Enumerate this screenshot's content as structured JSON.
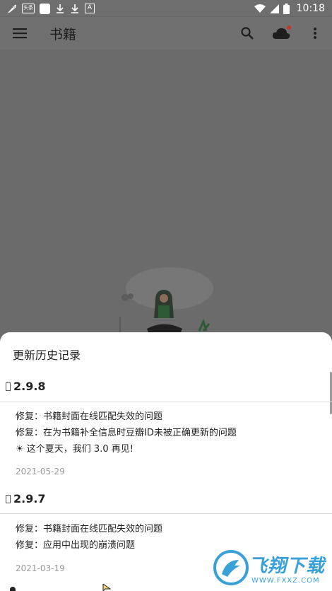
{
  "status_bar": {
    "icons_left": [
      "feather-icon",
      "news-app-icon",
      "square-app-icon",
      "download-icon",
      "download-icon",
      "font-a-icon"
    ],
    "news_badge": "头条",
    "a_badge": "A",
    "time": "10:18",
    "icons_right": [
      "wifi-icon",
      "signal-icon",
      "battery-icon"
    ]
  },
  "app_bar": {
    "title": "书籍",
    "icons": [
      "menu-icon",
      "search-icon",
      "cloud-icon",
      "more-vert-icon"
    ],
    "cloud_badge_color": "#c0392b"
  },
  "sheet": {
    "title": "更新历史记录",
    "versions": [
      {
        "version": "2.9.8",
        "items": [
          "修复：书籍封面在线匹配失效的问题",
          "修复：在为书籍补全信息时豆瓣ID未被正确更新的问题",
          "☀ 这个夏天，我们 3.0 再见!"
        ],
        "date": "2021-05-29"
      },
      {
        "version": "2.9.7",
        "items": [
          "修复：书籍封面在线匹配失效的问题",
          "修复：应用中出现的崩溃问题"
        ],
        "date": "2021-03-19"
      }
    ]
  },
  "watermark": {
    "name": "飞翔下载",
    "url": "WWW.FXXZ.COM",
    "color": "#3aa0d8"
  },
  "colors": {
    "scrim": "#6b6b6b",
    "sheet": "#ffffff",
    "text": "#222222",
    "muted": "#9a9a9a"
  }
}
